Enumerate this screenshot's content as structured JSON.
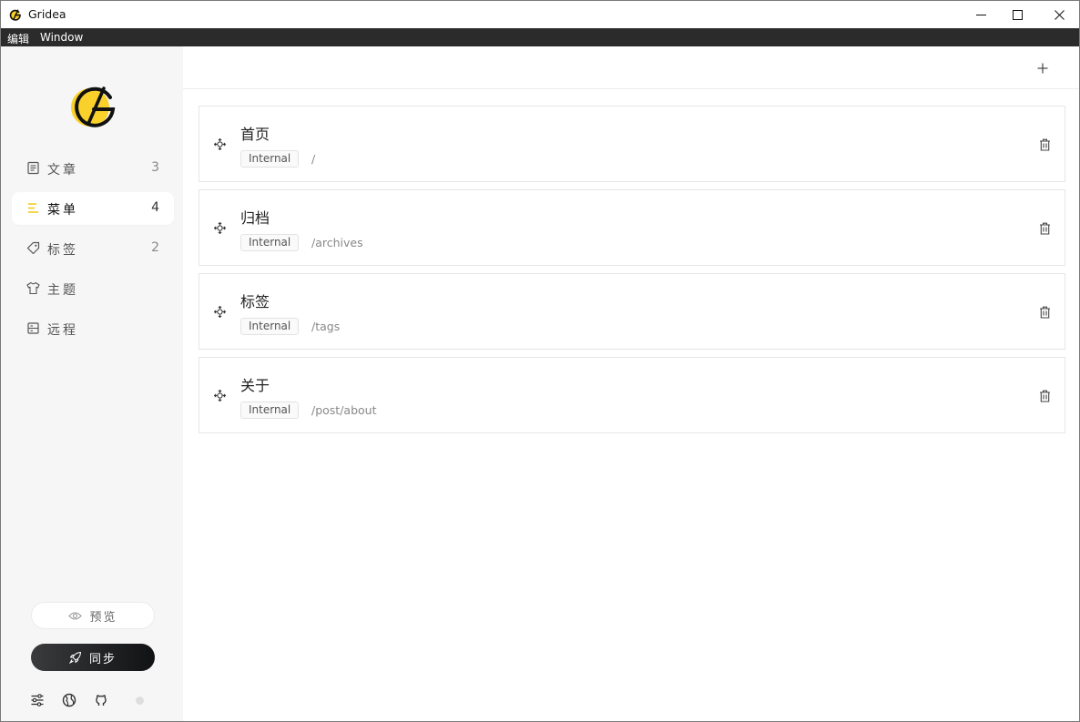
{
  "window": {
    "title": "Gridea"
  },
  "menubar": {
    "items": [
      "编辑",
      "Window"
    ]
  },
  "sidebar": {
    "nav": [
      {
        "label": "文章",
        "count": "3",
        "icon": "article-icon"
      },
      {
        "label": "菜单",
        "count": "4",
        "icon": "menu-icon",
        "active": true
      },
      {
        "label": "标签",
        "count": "2",
        "icon": "tag-icon"
      },
      {
        "label": "主题",
        "count": "",
        "icon": "theme-icon"
      },
      {
        "label": "远程",
        "count": "",
        "icon": "remote-icon"
      }
    ],
    "preview_label": "预览",
    "sync_label": "同步"
  },
  "menus": [
    {
      "name": "首页",
      "type": "Internal",
      "link": "/"
    },
    {
      "name": "归档",
      "type": "Internal",
      "link": "/archives"
    },
    {
      "name": "标签",
      "type": "Internal",
      "link": "/tags"
    },
    {
      "name": "关于",
      "type": "Internal",
      "link": "/post/about"
    }
  ],
  "colors": {
    "accent": "#f9d12a",
    "sidebar_bg": "#f7f6f7",
    "sync_bg": "#1b1c1e"
  }
}
